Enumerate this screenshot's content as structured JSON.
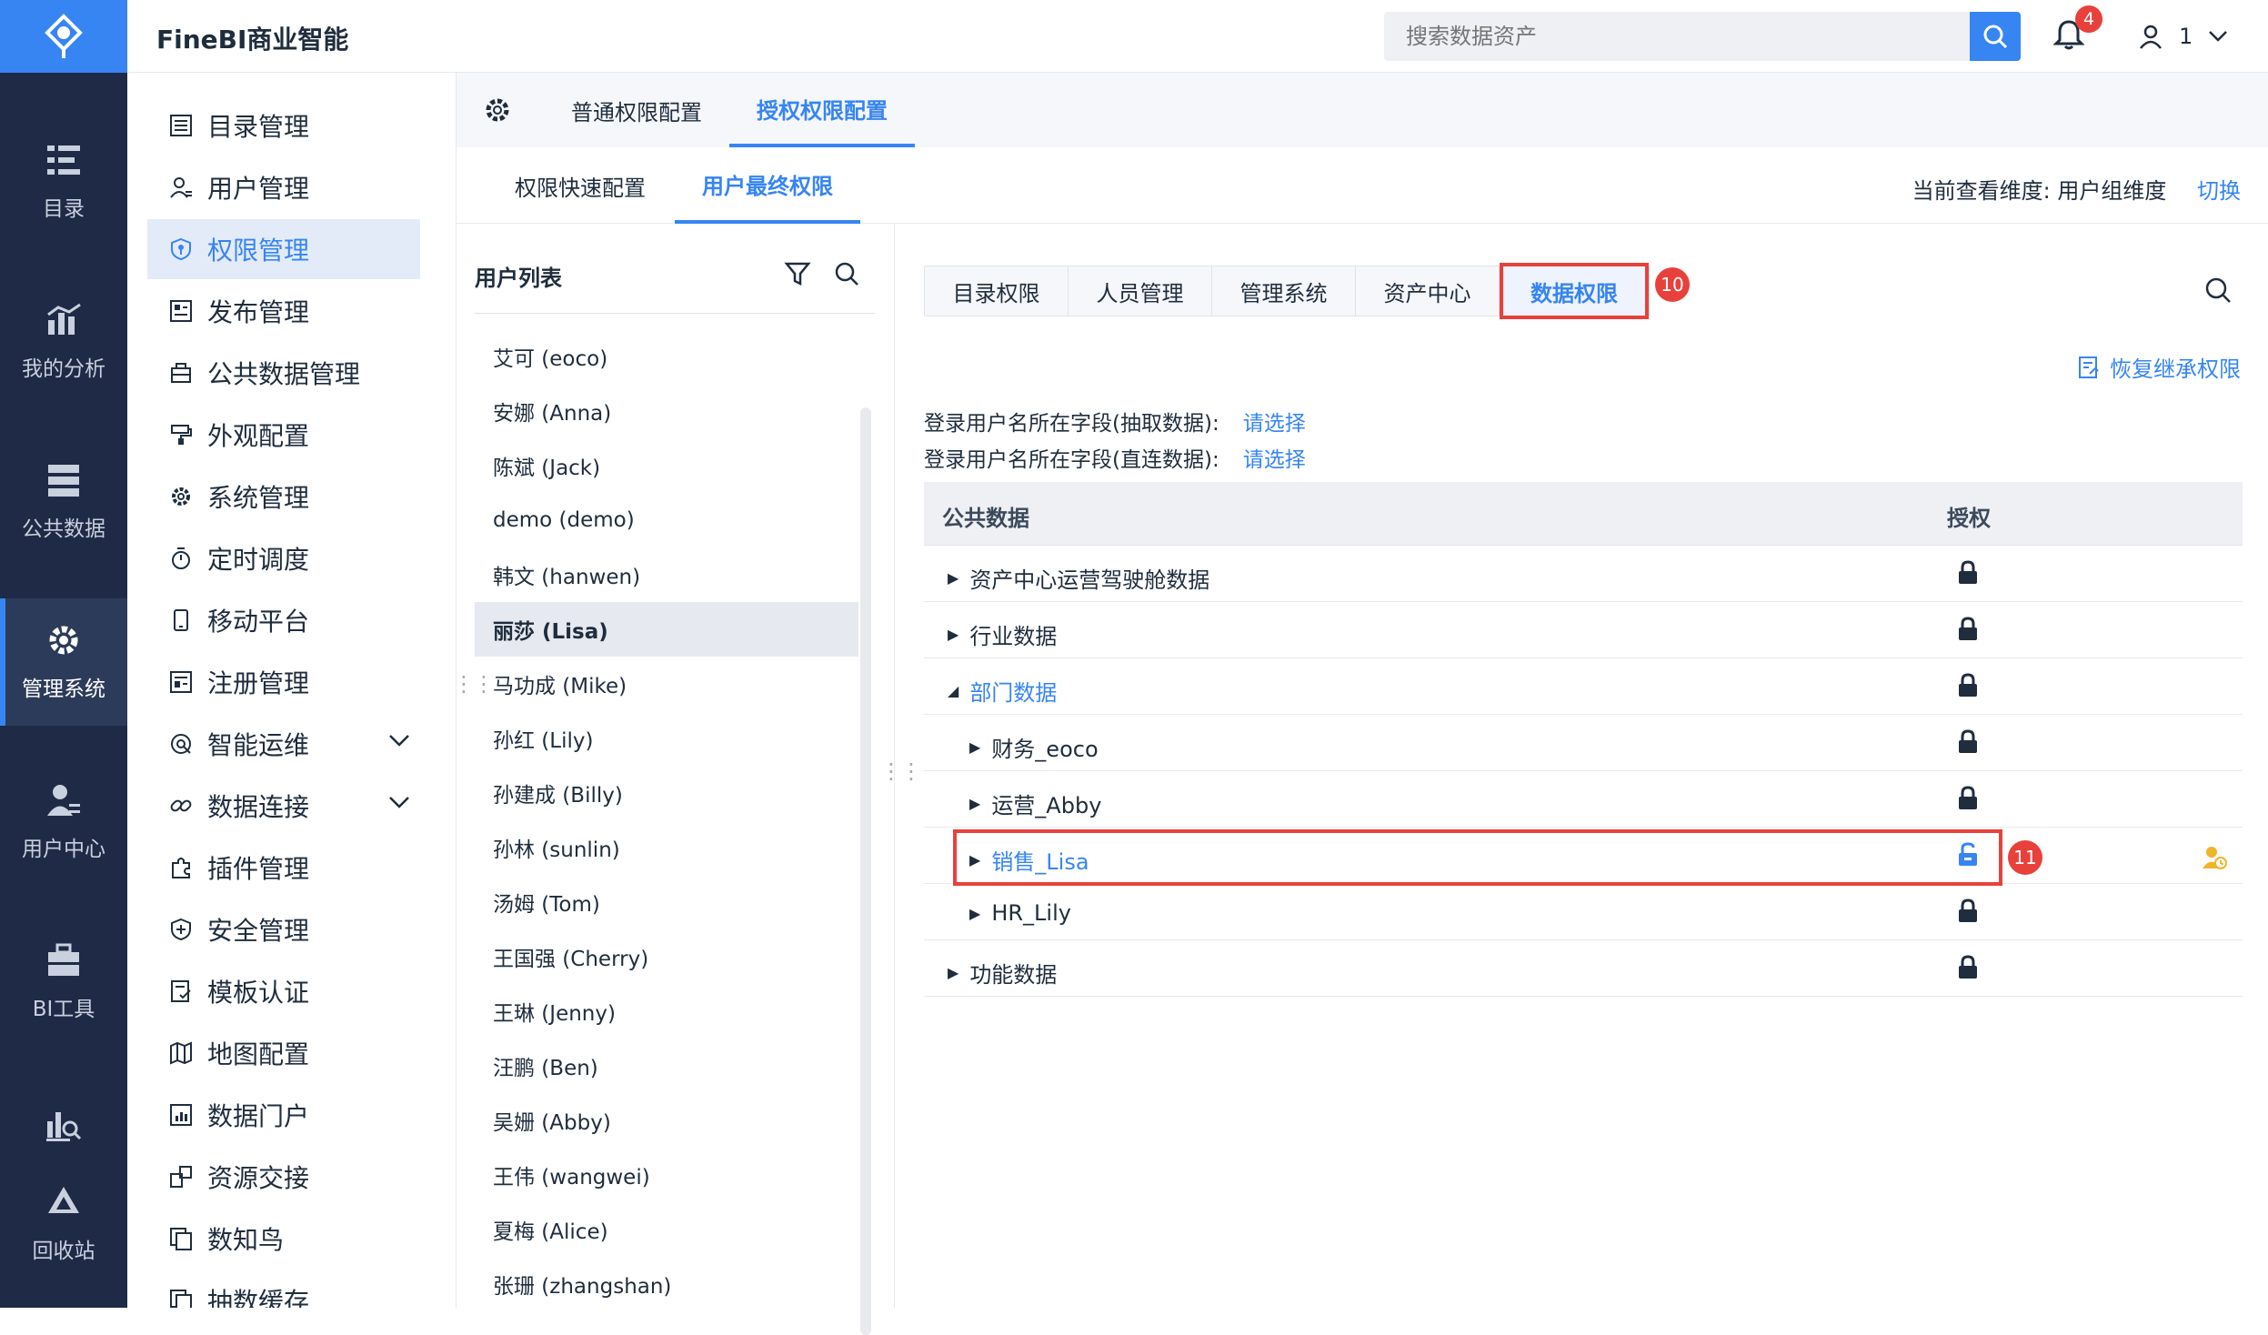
{
  "app": {
    "title": "FineBI商业智能"
  },
  "search": {
    "placeholder": "搜索数据资产"
  },
  "notifications": {
    "count": "4"
  },
  "user": {
    "name": "1"
  },
  "rail": [
    {
      "label": "目录",
      "icon": "catalog-icon"
    },
    {
      "label": "我的分析",
      "icon": "analysis-icon"
    },
    {
      "label": "公共数据",
      "icon": "public-data-icon"
    },
    {
      "label": "管理系统",
      "icon": "gear-icon",
      "active": true
    },
    {
      "label": "用户中心",
      "icon": "user-center-icon"
    },
    {
      "label": "BI工具",
      "icon": "toolbox-icon"
    },
    {
      "label": "",
      "icon": "chart-search-icon"
    },
    {
      "label": "回收站",
      "icon": "recycle-icon"
    }
  ],
  "menu": [
    {
      "label": "目录管理",
      "icon": "list-icon"
    },
    {
      "label": "用户管理",
      "icon": "user-icon"
    },
    {
      "label": "权限管理",
      "icon": "shield-icon",
      "active": true
    },
    {
      "label": "发布管理",
      "icon": "publish-icon"
    },
    {
      "label": "公共数据管理",
      "icon": "database-icon"
    },
    {
      "label": "外观配置",
      "icon": "paint-icon"
    },
    {
      "label": "系统管理",
      "icon": "gear-icon"
    },
    {
      "label": "定时调度",
      "icon": "timer-icon"
    },
    {
      "label": "移动平台",
      "icon": "mobile-icon"
    },
    {
      "label": "注册管理",
      "icon": "register-icon"
    },
    {
      "label": "智能运维",
      "icon": "ops-icon",
      "expand": true
    },
    {
      "label": "数据连接",
      "icon": "link-icon",
      "expand": true
    },
    {
      "label": "插件管理",
      "icon": "plugin-icon"
    },
    {
      "label": "安全管理",
      "icon": "security-icon"
    },
    {
      "label": "模板认证",
      "icon": "template-icon"
    },
    {
      "label": "地图配置",
      "icon": "map-icon"
    },
    {
      "label": "数据门户",
      "icon": "portal-icon"
    },
    {
      "label": "资源交接",
      "icon": "handover-icon"
    },
    {
      "label": "数知鸟",
      "icon": "copy-icon"
    },
    {
      "label": "抽数缓存",
      "icon": "cache-icon"
    }
  ],
  "tabs1": {
    "normal": "普通权限配置",
    "grant": "授权权限配置"
  },
  "tabs2": {
    "quick": "权限快速配置",
    "final": "用户最终权限"
  },
  "dimension": {
    "label": "当前查看维度:",
    "value": "用户组维度",
    "switch": "切换"
  },
  "user_list": {
    "title": "用户列表",
    "users": [
      "艾可 (eoco)",
      "安娜 (Anna)",
      "陈斌 (Jack)",
      "demo (demo)",
      "韩文 (hanwen)",
      "丽莎 (Lisa)",
      "马功成 (Mike)",
      "孙红 (Lily)",
      "孙建成 (Billy)",
      "孙林 (sunlin)",
      "汤姆 (Tom)",
      "王国强 (Cherry)",
      "王琳 (Jenny)",
      "汪鹏 (Ben)",
      "吴姗 (Abby)",
      "王伟 (wangwei)",
      "夏梅 (Alice)",
      "张珊 (zhangshan)"
    ],
    "active_index": 5
  },
  "data_tabs": [
    "目录权限",
    "人员管理",
    "管理系统",
    "资产中心",
    "数据权限"
  ],
  "callouts": {
    "tab": "10",
    "row": "11"
  },
  "restore": "恢复继承权限",
  "fields": [
    {
      "label": "登录用户名所在字段(抽取数据):",
      "value": "请选择"
    },
    {
      "label": "登录用户名所在字段(直连数据):",
      "value": "请选择"
    }
  ],
  "table": {
    "col1": "公共数据",
    "col2": "授权",
    "rows": [
      {
        "name": "资产中心运营驾驶舱数据",
        "level": 0,
        "arrow": "right",
        "lock": "locked"
      },
      {
        "name": "行业数据",
        "level": 0,
        "arrow": "right",
        "lock": "locked"
      },
      {
        "name": "部门数据",
        "level": 0,
        "arrow": "down",
        "lock": "locked",
        "blue": true
      },
      {
        "name": "财务_eoco",
        "level": 1,
        "arrow": "right",
        "lock": "locked"
      },
      {
        "name": "运营_Abby",
        "level": 1,
        "arrow": "right",
        "lock": "locked"
      },
      {
        "name": "销售_Lisa",
        "level": 1,
        "arrow": "right",
        "lock": "unlocked",
        "blue": true,
        "highlight": true
      },
      {
        "name": "HR_Lily",
        "level": 1,
        "arrow": "right",
        "lock": "locked"
      },
      {
        "name": "功能数据",
        "level": 0,
        "arrow": "right",
        "lock": "locked"
      }
    ]
  }
}
